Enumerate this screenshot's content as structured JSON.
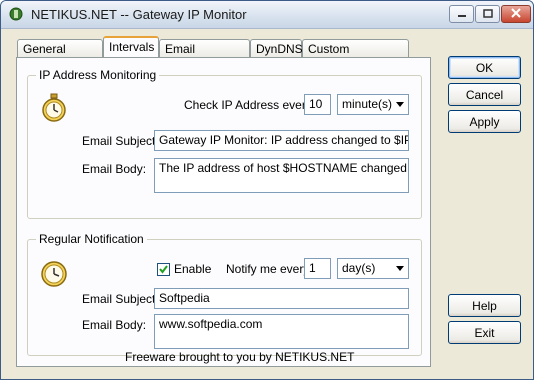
{
  "window": {
    "title": "NETIKUS.NET -- Gateway IP Monitor"
  },
  "tabs": [
    {
      "label": "General Options"
    },
    {
      "label": "Intervals"
    },
    {
      "label": "Email Notification"
    },
    {
      "label": "DynDNS"
    },
    {
      "label": "Custom Notifications"
    }
  ],
  "ip_monitoring": {
    "group_title": "IP Address Monitoring",
    "check_label": "Check IP Address every",
    "check_value": "10",
    "unit_selected": "minute(s)",
    "subject_label": "Email Subject:",
    "subject_value": "Gateway IP Monitor: IP address changed to $IP",
    "body_label": "Email Body:",
    "body_value": "The IP address of host $HOSTNAME changed from"
  },
  "regular_notification": {
    "group_title": "Regular Notification",
    "enable_label": "Enable",
    "enable_checked": true,
    "notify_label": "Notify me every",
    "notify_value": "1",
    "unit_selected": "day(s)",
    "subject_label": "Email Subject:",
    "subject_value": "Softpedia",
    "body_label": "Email Body:",
    "body_value": "www.softpedia.com"
  },
  "buttons": {
    "ok": "OK",
    "cancel": "Cancel",
    "apply": "Apply",
    "help": "Help",
    "exit": "Exit"
  },
  "footer": "Freeware brought to you by NETIKUS.NET"
}
